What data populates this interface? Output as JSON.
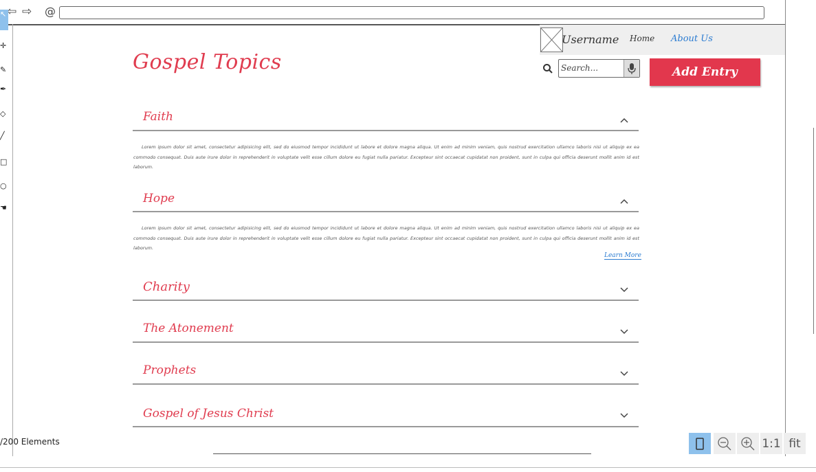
{
  "browser": {
    "back_icon": "back-arrow-icon",
    "forward_icon": "forward-arrow-icon",
    "url": ""
  },
  "header": {
    "username": "Username",
    "nav": {
      "home": "Home",
      "about": "About Us"
    },
    "search_placeholder": "Search...",
    "add_entry": "Add Entry"
  },
  "page": {
    "title": "Gospel Topics"
  },
  "topics": [
    {
      "title": "Faith",
      "expanded": true,
      "body": "Lorem ipsum dolor sit amet, consectetur adipisicing elit, sed do eiusmod tempor incididunt ut labore et dolore magna aliqua. Ut enim ad minim veniam, quis nostrud exercitation ullamco laboris nisi ut aliquip ex ea commodo consequat. Duis aute irure dolor in reprehenderit in voluptate velit esse cillum dolore eu fugiat nulla pariatur. Excepteur sint occaecat cupidatat non proident, sunt in culpa qui officia deserunt mollit anim id est laborum."
    },
    {
      "title": "Hope",
      "expanded": true,
      "body": "Lorem ipsum dolor sit amet, consectetur adipisicing elit, sed do eiusmod tempor incididunt ut labore et dolore magna aliqua. Ut enim ad minim veniam, quis nostrud exercitation ullamco laboris nisi ut aliquip ex ea commodo consequat. Duis aute irure dolor in reprehenderit in voluptate velit esse cillum dolore eu fugiat nulla pariatur. Excepteur sint occaecat cupidatat non proident, sunt in culpa qui officia deserunt mollit anim id est laborum.",
      "link": "Learn More"
    },
    {
      "title": "Charity",
      "expanded": false
    },
    {
      "title": "The Atonement",
      "expanded": false
    },
    {
      "title": "Prophets",
      "expanded": false
    },
    {
      "title": "Gospel of Jesus Christ",
      "expanded": false
    }
  ],
  "footer": {
    "elements_count": "/200 Elements",
    "zoom": {
      "one_to_one": "1:1",
      "fit": "fit"
    }
  },
  "colors": {
    "accent": "#e03c4f",
    "button": "#e2374d",
    "link": "#2a7bd1",
    "selected_tool": "#8ec1ec"
  }
}
